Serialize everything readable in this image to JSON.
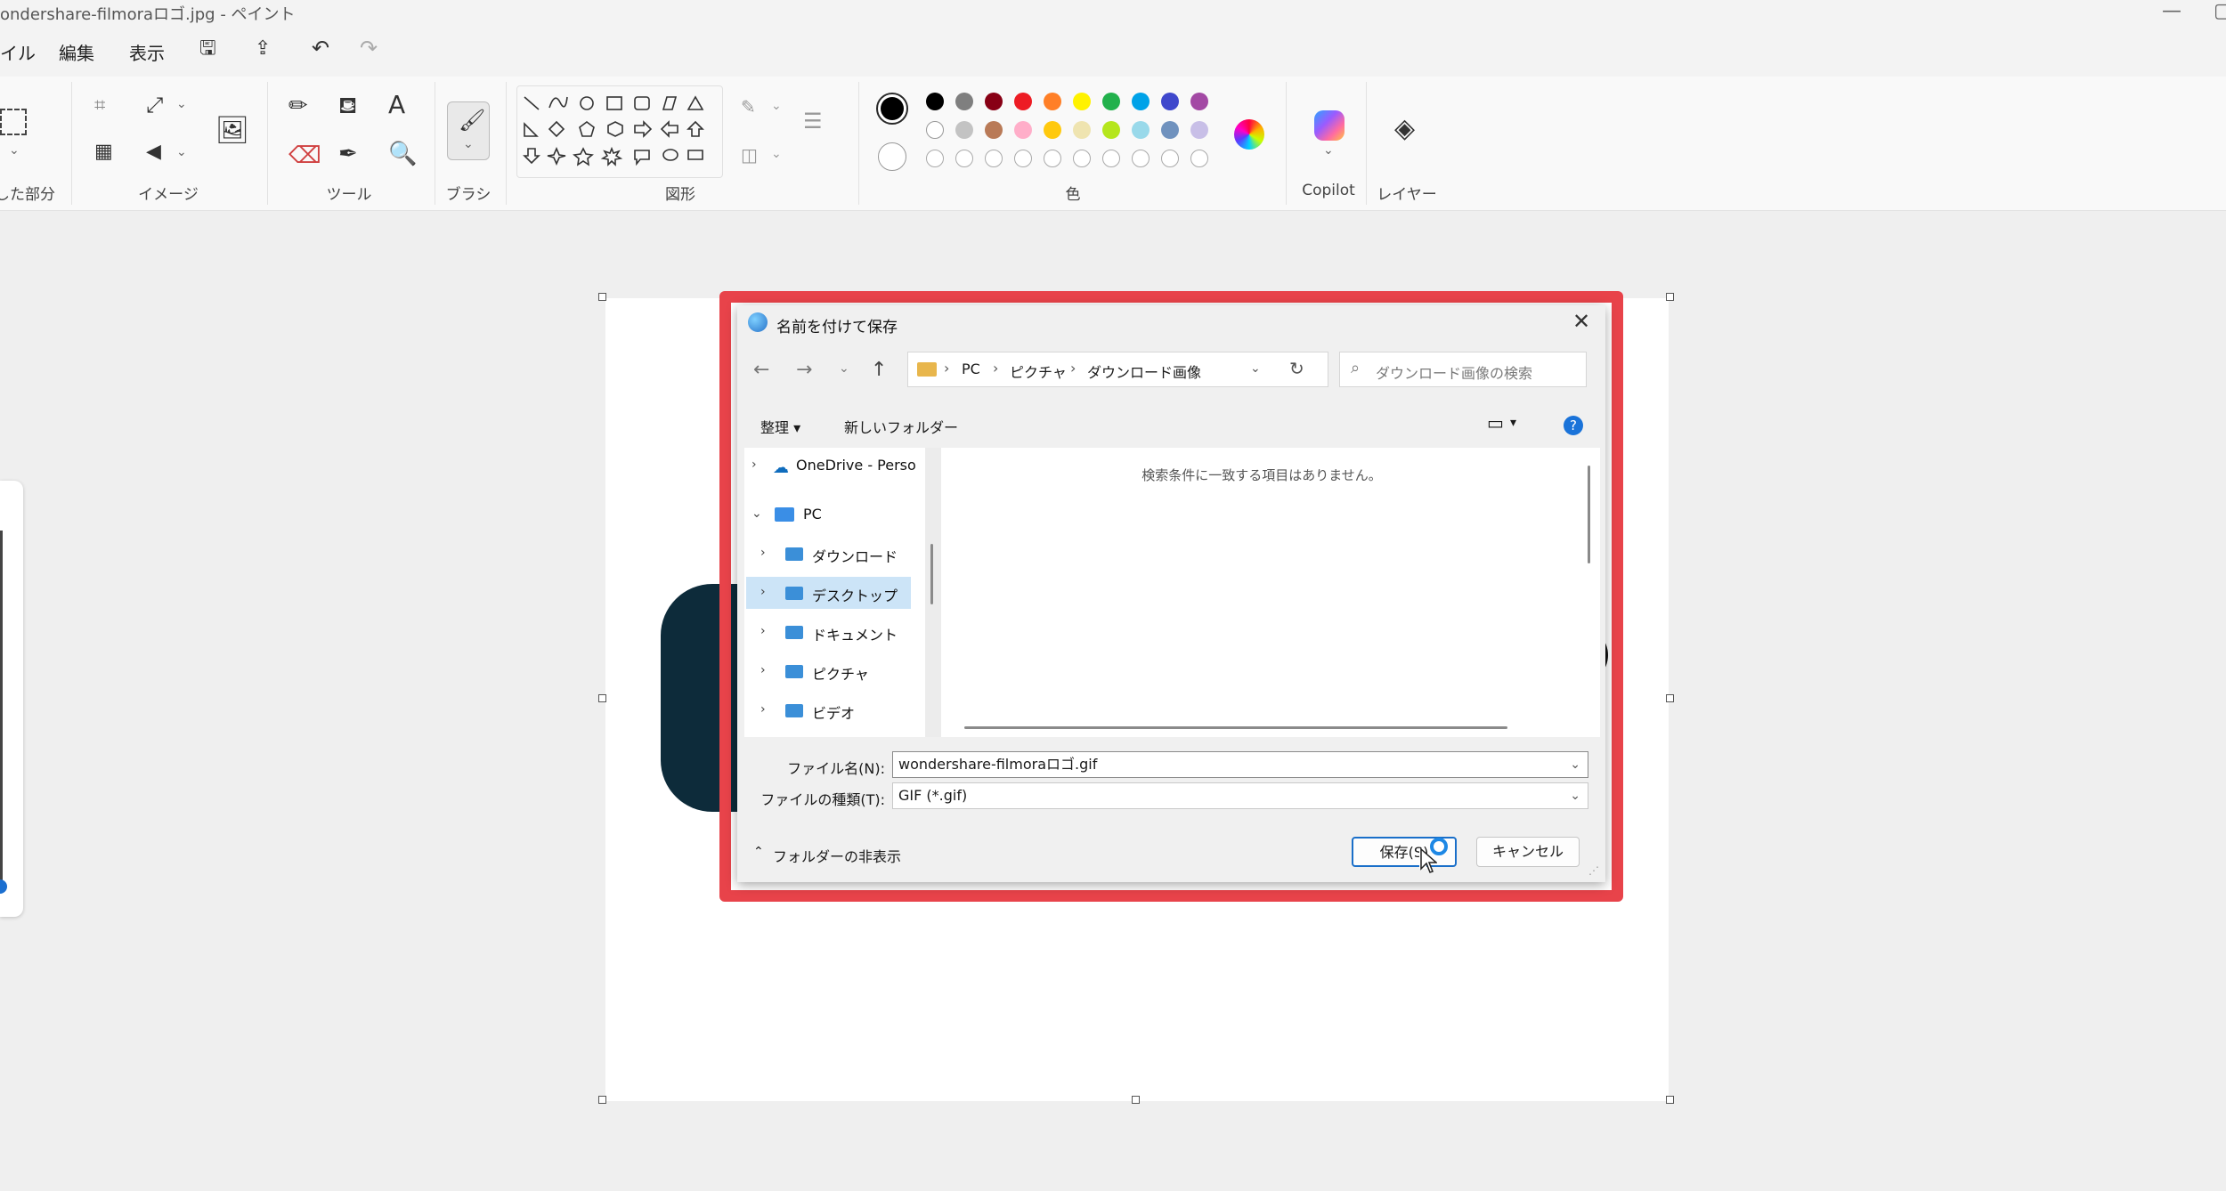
{
  "window": {
    "title": "ondershare-filmoraロゴ.jpg - ペイント"
  },
  "menu": {
    "file": "イル",
    "edit": "編集",
    "view": "表示"
  },
  "ribbon": {
    "groups": {
      "selection": "した部分",
      "image": "イメージ",
      "tools": "ツール",
      "brush": "ブラシ",
      "shapes": "図形",
      "colors": "色",
      "copilot": "Copilot",
      "layers": "レイヤー"
    },
    "palette_row1": [
      "#000000",
      "#7f7f7f",
      "#880015",
      "#ed1c24",
      "#ff7f27",
      "#fff200",
      "#22b14c",
      "#00a2e8",
      "#3f48cc",
      "#a349a4"
    ],
    "palette_row2": [
      "#ffffff",
      "#c3c3c3",
      "#b97a57",
      "#ffaec9",
      "#ffc90e",
      "#efe4b0",
      "#b5e61d",
      "#99d9ea",
      "#7092be",
      "#c8bfe7"
    ],
    "primary_color": "#000000",
    "secondary_color": "#ffffff"
  },
  "dialog": {
    "title": "名前を付けて保存",
    "breadcrumb": [
      "PC",
      "ピクチャ",
      "ダウンロード画像"
    ],
    "search_placeholder": "ダウンロード画像の検索",
    "toolbar": {
      "organize": "整理 ▾",
      "new_folder": "新しいフォルダー"
    },
    "nav_items": [
      {
        "label": "OneDrive - Perso",
        "icon": "onedrive-cloud-icon"
      },
      {
        "label": "PC",
        "icon": "pc-icon"
      },
      {
        "label": "ダウンロード",
        "icon": "folder-icon"
      },
      {
        "label": "デスクトップ",
        "icon": "folder-icon"
      },
      {
        "label": "ドキュメント",
        "icon": "folder-icon"
      },
      {
        "label": "ピクチャ",
        "icon": "folder-icon"
      },
      {
        "label": "ビデオ",
        "icon": "folder-icon"
      }
    ],
    "empty_message": "検索条件に一致する項目はありません。",
    "filename_label": "ファイル名(N):",
    "filename_value": "wondershare-filmoraロゴ.gif",
    "filetype_label": "ファイルの種類(T):",
    "filetype_value": "GIF (*.gif)",
    "hide_folders": "フォルダーの非表示",
    "save_button": "保存(S)",
    "cancel_button": "キャンセル"
  },
  "accent": {
    "highlight": "#e8434a",
    "selection_blue": "#cce4f7"
  }
}
